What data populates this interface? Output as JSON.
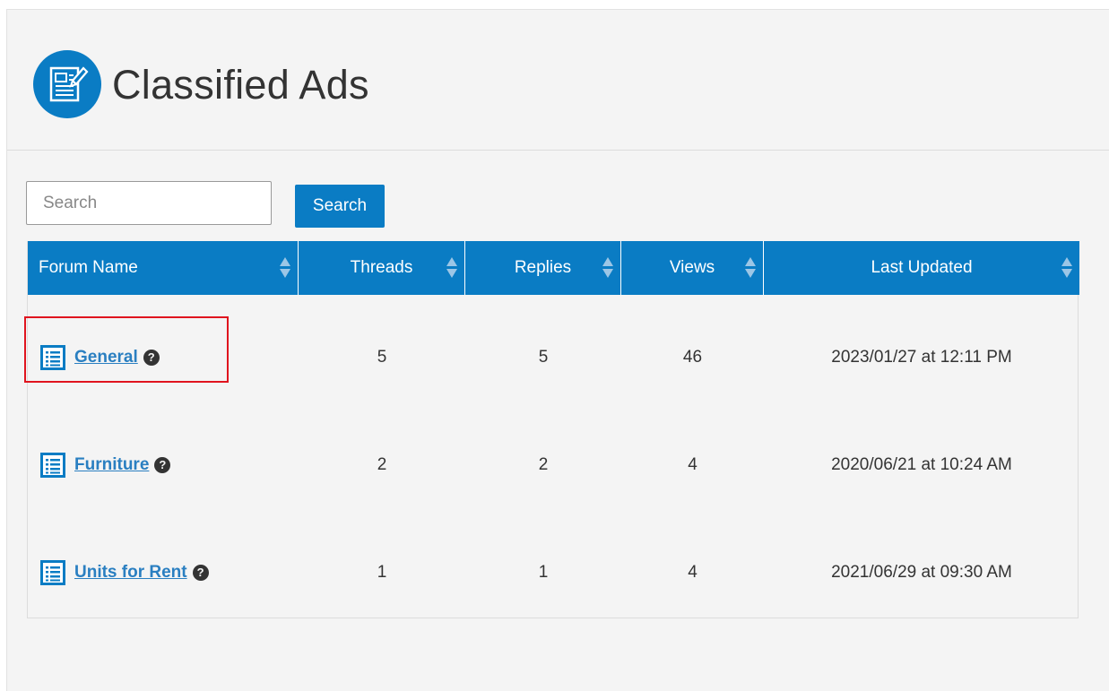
{
  "header": {
    "title": "Classified Ads",
    "logo_icon": "newspaper-pen-icon",
    "accent_color": "#0a7cc4"
  },
  "search": {
    "placeholder": "Search",
    "value": "",
    "button_label": "Search"
  },
  "table": {
    "columns": [
      {
        "label": "Forum Name"
      },
      {
        "label": "Threads"
      },
      {
        "label": "Replies"
      },
      {
        "label": "Views"
      },
      {
        "label": "Last Updated"
      }
    ],
    "rows": [
      {
        "name": "General",
        "threads": "5",
        "replies": "5",
        "views": "46",
        "last_updated": "2023/01/27 at 12:11 PM"
      },
      {
        "name": "Furniture",
        "threads": "2",
        "replies": "2",
        "views": "4",
        "last_updated": "2020/06/21 at 10:24 AM"
      },
      {
        "name": "Units for Rent",
        "threads": "1",
        "replies": "1",
        "views": "4",
        "last_updated": "2021/06/29 at 09:30 AM"
      }
    ],
    "row_icon": "list-icon",
    "help_icon": "question-circle-icon",
    "help_glyph": "?"
  },
  "highlight": {
    "color": "#e0141e",
    "target": "General"
  }
}
